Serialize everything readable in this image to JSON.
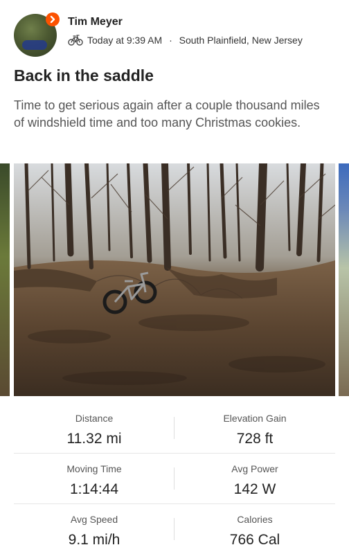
{
  "athlete": {
    "name": "Tim Meyer",
    "timestamp": "Today at 9:39 AM",
    "separator": " · ",
    "location": "South Plainfield, New Jersey",
    "activity_icon": "bicycle-icon",
    "badge_icon": "strava-chevron-icon",
    "accent_color": "#fc5200"
  },
  "activity": {
    "title": "Back in the saddle",
    "description": "Time to get serious again after a couple thousand miles of windshield time and too many Christmas cookies."
  },
  "stats": [
    {
      "label": "Distance",
      "value": "11.32 mi"
    },
    {
      "label": "Elevation Gain",
      "value": "728 ft"
    },
    {
      "label": "Moving Time",
      "value": "1:14:44"
    },
    {
      "label": "Avg Power",
      "value": "142 W"
    },
    {
      "label": "Avg Speed",
      "value": "9.1 mi/h"
    },
    {
      "label": "Calories",
      "value": "766 Cal"
    }
  ]
}
